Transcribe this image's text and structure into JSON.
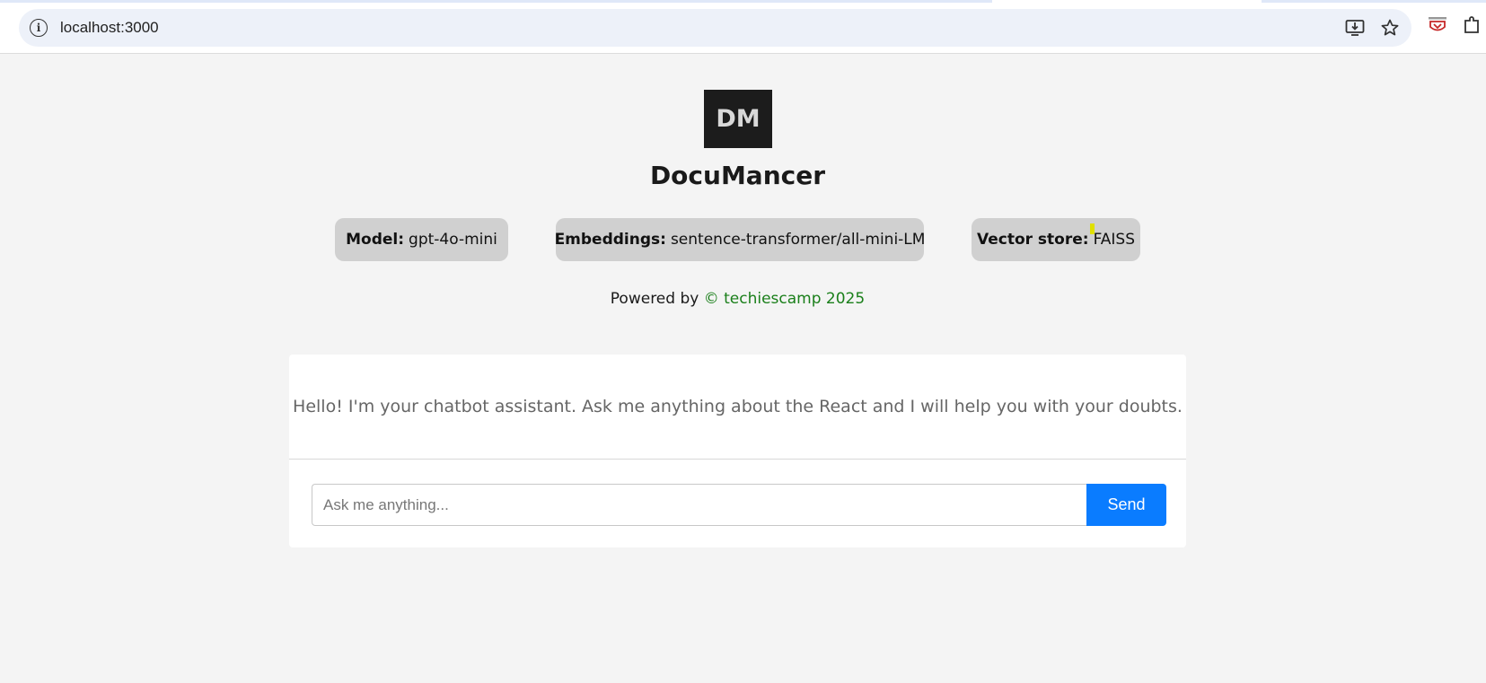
{
  "browser": {
    "url": "localhost:3000",
    "info_icon": "info-icon",
    "install_icon": "install-app-icon",
    "bookmark_icon": "star-icon",
    "extension_icon": "extension-icon",
    "puzzle_icon": "puzzle-icon"
  },
  "app": {
    "logo_text": "DM",
    "title": "DocuMancer",
    "info": {
      "model_label": "Model:",
      "model_value": "gpt-4o-mini",
      "embeddings_label": "Embeddings:",
      "embeddings_value": "sentence-transformer/all-mini-LM",
      "vector_label": "Vector store:",
      "vector_value": "FAISS"
    },
    "powered_prefix": "Powered by",
    "powered_link": "© techiescamp 2025"
  },
  "chat": {
    "greeting": "Hello! I'm your chatbot assistant. Ask me anything about the React and I will help you with your doubts.",
    "input_value": "",
    "input_placeholder": "Ask me anything...",
    "send_label": "Send"
  },
  "colors": {
    "page_bg": "#f4f4f4",
    "logo_bg": "#1c1c1c",
    "pill_bg": "#d0d0d0",
    "link_green": "#1a7f1a",
    "send_blue": "#0a7cff"
  }
}
